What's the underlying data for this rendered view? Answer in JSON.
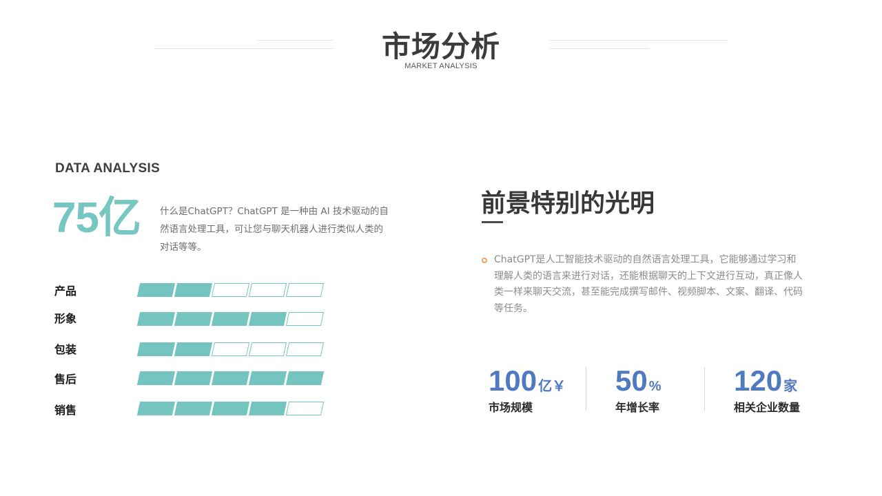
{
  "header": {
    "title": "市场分析",
    "subtitle": "MARKET ANALYSIS"
  },
  "left": {
    "section_label": "DATA ANALYSIS",
    "big_number": "75亿",
    "intro": "什么是ChatGPT？ChatGPT 是一种由 AI 技术驱动的自然语言处理工具，可让您与聊天机器人进行类似人类的对话等等。",
    "bars": [
      {
        "label": "产品",
        "level": 2,
        "max": 5
      },
      {
        "label": "形象",
        "level": 4,
        "max": 5
      },
      {
        "label": "包装",
        "level": 2,
        "max": 5
      },
      {
        "label": "售后",
        "level": 5,
        "max": 5
      },
      {
        "label": "销售",
        "level": 4,
        "max": 5
      }
    ]
  },
  "right": {
    "heading": "前景特别的光明",
    "description": "ChatGPT是人工智能技术驱动的自然语言处理工具，它能够通过学习和理解人类的语言来进行对话，还能根据聊天的上下文进行互动，真正像人类一样来聊天交流，甚至能完成撰写邮件、视频脚本、文案、翻译、代码等任务。",
    "stats": [
      {
        "number": "100",
        "unit": "亿￥",
        "label": "市场规模"
      },
      {
        "number": "50",
        "unit": "%",
        "label": "年增长率"
      },
      {
        "number": "120",
        "unit": "家",
        "label": "相关企业数量"
      }
    ]
  },
  "colors": {
    "teal": "#74c5c0",
    "blue": "#4f7abf",
    "bullet": "#f0a15f"
  }
}
